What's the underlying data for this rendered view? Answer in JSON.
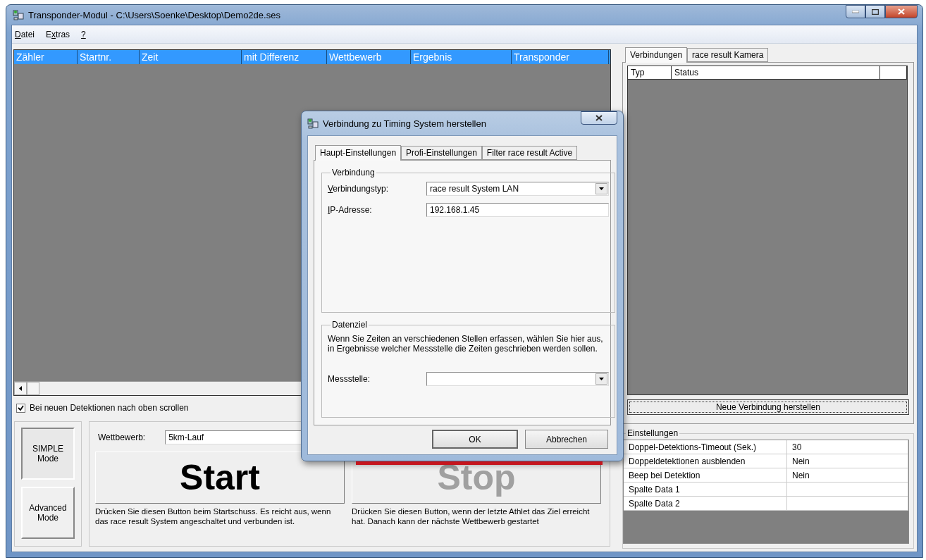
{
  "window": {
    "title": "Transponder-Modul - C:\\Users\\Soenke\\Desktop\\Demo2de.ses"
  },
  "menu": [
    {
      "parts": [
        {
          "text": "D",
          "underline": true
        },
        {
          "text": "atei",
          "underline": false
        }
      ]
    },
    {
      "parts": [
        {
          "text": "E",
          "underline": false
        },
        {
          "text": "x",
          "underline": true
        },
        {
          "text": "tras",
          "underline": false
        }
      ]
    },
    {
      "parts": [
        {
          "text": "?",
          "underline": true
        }
      ]
    }
  ],
  "detections_table": {
    "columns": [
      "Zähler",
      "Startnr.",
      "Zeit",
      "mit Differenz",
      "Wettbewerb",
      "Ergebnis",
      "Transponder"
    ]
  },
  "scroll_checkbox": {
    "label": "Bei neuen Detektionen nach oben scrollen",
    "checked": true
  },
  "modes": [
    {
      "label": "SIMPLE Mode",
      "selected": true
    },
    {
      "label": "Advanced Mode",
      "selected": false
    }
  ],
  "competition": {
    "label": "Wettbewerb:",
    "value": "5km-Lauf"
  },
  "actions": [
    {
      "label": "Start",
      "disabled": false,
      "description": "Drücken Sie diesen Button beim Startschuss. Es reicht aus, wenn das race result System angeschaltet und verbunden ist."
    },
    {
      "label": "Stop",
      "disabled": true,
      "description": "Drücken Sie diesen Button, wenn der letzte Athlet das Ziel erreicht hat. Danach kann der nächste Wettbewerb gestartet"
    }
  ],
  "right_tabs": [
    {
      "label": "Verbindungen",
      "selected": true
    },
    {
      "label": "race result Kamera",
      "selected": false
    }
  ],
  "connections_table": {
    "columns": [
      "Typ",
      "Status"
    ]
  },
  "new_connection_button": "Neue Verbindung herstellen",
  "settings": {
    "title": "Einstellungen",
    "rows": [
      {
        "name": "Doppel-Detektions-Timeout (Sek.)",
        "value": "30"
      },
      {
        "name": "Doppeldetektionen ausblenden",
        "value": "Nein"
      },
      {
        "name": "Beep bei Detektion",
        "value": "Nein"
      },
      {
        "name": "Spalte Data 1"
      },
      {
        "name": "Spalte Data 2"
      }
    ]
  },
  "dialog": {
    "title": "Verbindung zu Timing System herstellen",
    "tabs": [
      {
        "label": "Haupt-Einstellungen",
        "selected": true
      },
      {
        "label": "Profi-Einstellungen",
        "selected": false
      },
      {
        "label": "Filter race result Active",
        "selected": false
      }
    ],
    "connection_group": {
      "title": "Verbindung",
      "fields": [
        {
          "kind": "select",
          "parts": [
            {
              "text": "V",
              "underline": true
            },
            {
              "text": "erbindungstyp:",
              "underline": false
            }
          ],
          "value": "race result System LAN"
        },
        {
          "kind": "text",
          "parts": [
            {
              "text": "I",
              "underline": true
            },
            {
              "text": "P-Adresse:",
              "underline": false
            }
          ],
          "value": "192.168.1.45"
        }
      ]
    },
    "target_group": {
      "title": "Datenziel",
      "description": "Wenn Sie Zeiten an verschiedenen Stellen erfassen, wählen Sie hier aus, in Ergebnisse welcher Messstelle die Zeiten geschrieben werden sollen.",
      "fields": [
        {
          "kind": "select",
          "parts": [
            {
              "text": "Messstelle:",
              "underline": false
            }
          ]
        }
      ]
    },
    "buttons": [
      "OK",
      "Abbrechen"
    ]
  }
}
